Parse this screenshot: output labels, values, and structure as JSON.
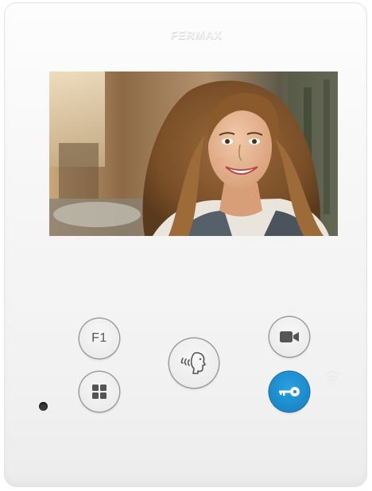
{
  "device": {
    "brand": "FERMAX",
    "screen_image": "smiling-woman-at-door",
    "buttons": {
      "f1_label": "F1",
      "menu_icon": "grid-menu-icon",
      "talk_icon": "talk-speech-icon",
      "camera_icon": "video-camera-icon",
      "door_icon": "key-icon"
    },
    "indicators": {
      "wifi_icon": "wifi-icon",
      "status_led": "status-led"
    }
  },
  "colors": {
    "door_button": "#1a88c9",
    "body": "#f6f6f6",
    "icon": "#555555"
  }
}
